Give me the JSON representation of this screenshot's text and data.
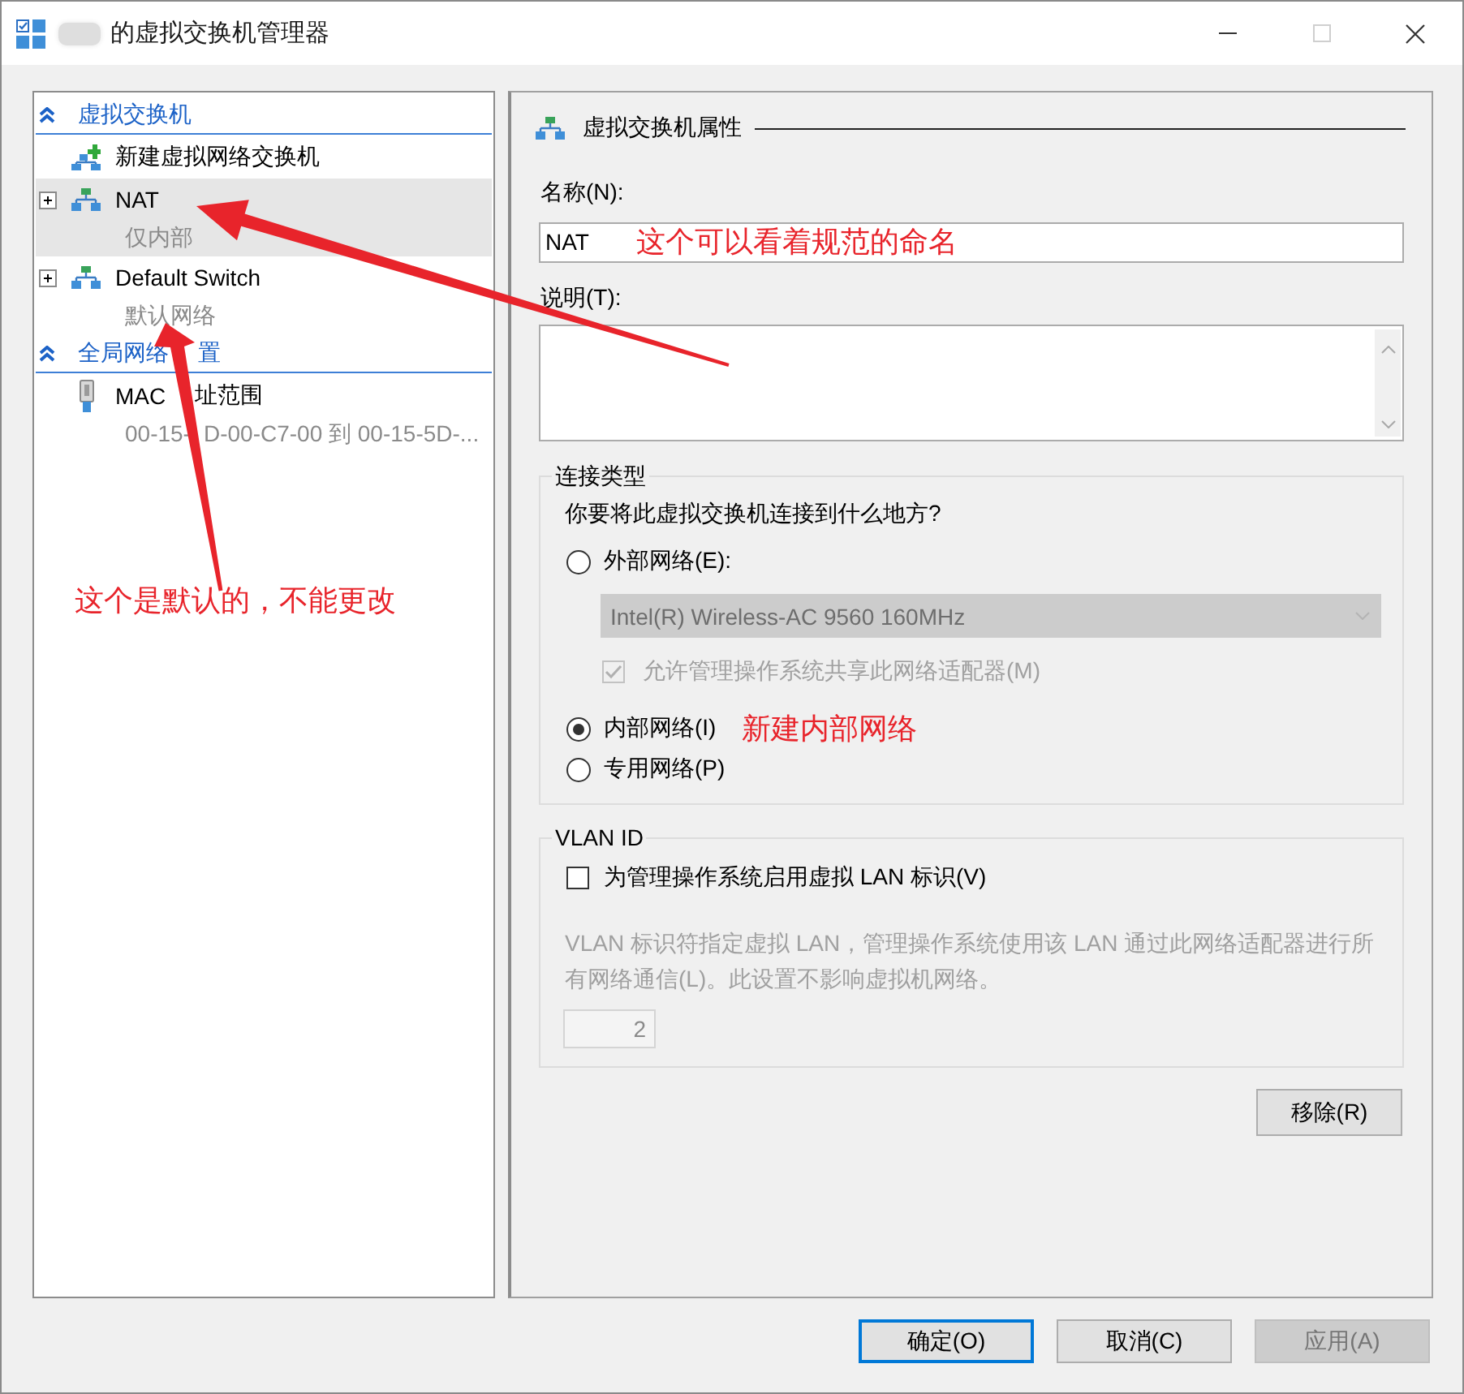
{
  "window": {
    "title": "的虚拟交换机管理器"
  },
  "sidebar": {
    "sections": [
      {
        "title": "虚拟交换机",
        "expanded": true,
        "items": [
          {
            "kind": "new-switch",
            "label": "新建虚拟网络交换机",
            "selected": false
          },
          {
            "kind": "switch",
            "label": "NAT",
            "sublabel": "仅内部",
            "selected": true,
            "expanded": false
          },
          {
            "kind": "switch",
            "label": "Default Switch",
            "sublabel": "默认网络",
            "selected": false,
            "expanded": false
          }
        ]
      },
      {
        "title": [
          "全局网络",
          "置"
        ],
        "expanded": true,
        "items": [
          {
            "kind": "mac-range",
            "label": [
              "MAC",
              "址范围"
            ],
            "sublabel": [
              "00-15-",
              "D-00-C7-00 到 00-15-5D-..."
            ],
            "selected": false
          }
        ]
      }
    ],
    "annotation": "这个是默认的，不能更改"
  },
  "properties": {
    "title": "虚拟交换机属性",
    "name_label": "名称(N):",
    "name_value": "NAT",
    "name_annotation": "这个可以看着规范的命名",
    "description_label": "说明(T):"
  },
  "connection_type": {
    "title": "连接类型",
    "question": "你要将此虚拟交换机连接到什么地方?",
    "options": [
      {
        "label": "外部网络(E):",
        "selected": false,
        "adapter": {
          "value": "Intel(R) Wireless-AC 9560 160MHz",
          "disabled": true
        },
        "share": {
          "label": "允许管理操作系统共享此网络适配器(M)",
          "checked": true,
          "disabled": true
        }
      },
      {
        "label": "内部网络(I)",
        "selected": true,
        "annotation": "新建内部网络"
      },
      {
        "label": "专用网络(P)",
        "selected": false
      }
    ]
  },
  "vlan": {
    "title": "VLAN ID",
    "enable": {
      "label": "为管理操作系统启用虚拟 LAN 标识(V)",
      "checked": false
    },
    "note": "VLAN 标识符指定虚拟 LAN，管理操作系统使用该 LAN 通过此网络适配器进行所有网络通信(L)。此设置不影响虚拟机网络。",
    "vlan_id": {
      "value": "2",
      "disabled": true
    }
  },
  "remove_button": "移除(R)",
  "buttons": [
    {
      "label": "确定(O)",
      "default": true,
      "disabled": false
    },
    {
      "label": "取消(C)",
      "default": false,
      "disabled": false
    },
    {
      "label": "应用(A)",
      "default": false,
      "disabled": true
    }
  ]
}
